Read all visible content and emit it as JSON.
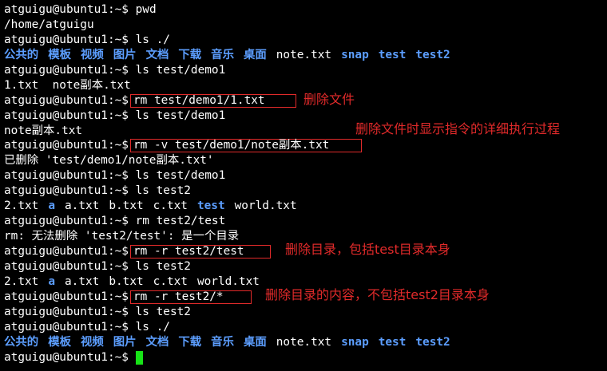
{
  "prompt": "atguigu@ubuntu1:~$",
  "lines": [
    {
      "cmd": "pwd"
    },
    {
      "out": "/home/atguigu"
    },
    {
      "cmd": "ls ./"
    },
    {
      "cmd": "ls test/demo1"
    },
    {
      "out": "1.txt  note副本.txt"
    },
    {
      "cmd": "rm test/demo1/1.txt"
    },
    {
      "cmd": "ls test/demo1"
    },
    {
      "out": "note副本.txt"
    },
    {
      "cmd": "rm -v test/demo1/note副本.txt"
    },
    {
      "out": "已删除 'test/demo1/note副本.txt'"
    },
    {
      "cmd": "ls test/demo1"
    },
    {
      "cmd": "ls test2"
    },
    {
      "cmd": "rm test2/test"
    },
    {
      "out": "rm: 无法删除 'test2/test': 是一个目录"
    },
    {
      "cmd": "rm -r test2/test"
    },
    {
      "cmd": "ls test2"
    },
    {
      "cmd": "rm -r test2/*"
    },
    {
      "cmd": "ls test2"
    },
    {
      "cmd": "ls ./"
    }
  ],
  "home_listing": [
    "公共的",
    "模板",
    "视频",
    "图片",
    "文档",
    "下载",
    "音乐",
    "桌面",
    "note.txt",
    "snap",
    "test",
    "test2"
  ],
  "test2_listing_1": [
    "2.txt",
    "a",
    "a.txt",
    "b.txt",
    "c.txt",
    "test",
    "world.txt"
  ],
  "test2_listing_2": [
    "2.txt",
    "a",
    "a.txt",
    "b.txt",
    "c.txt",
    "world.txt"
  ],
  "annotations": {
    "rm_file": "删除文件",
    "rm_verbose": "删除文件时显示指令的详细执行过程",
    "rm_dir": "删除目录，包括test目录本身",
    "rm_contents": "删除目录的内容，不包括test2目录本身"
  },
  "colors": {
    "background": "#000000",
    "text": "#ffffff",
    "directory": "#5c9eff",
    "annotation": "#e12a2a",
    "cursor": "#17e317"
  }
}
